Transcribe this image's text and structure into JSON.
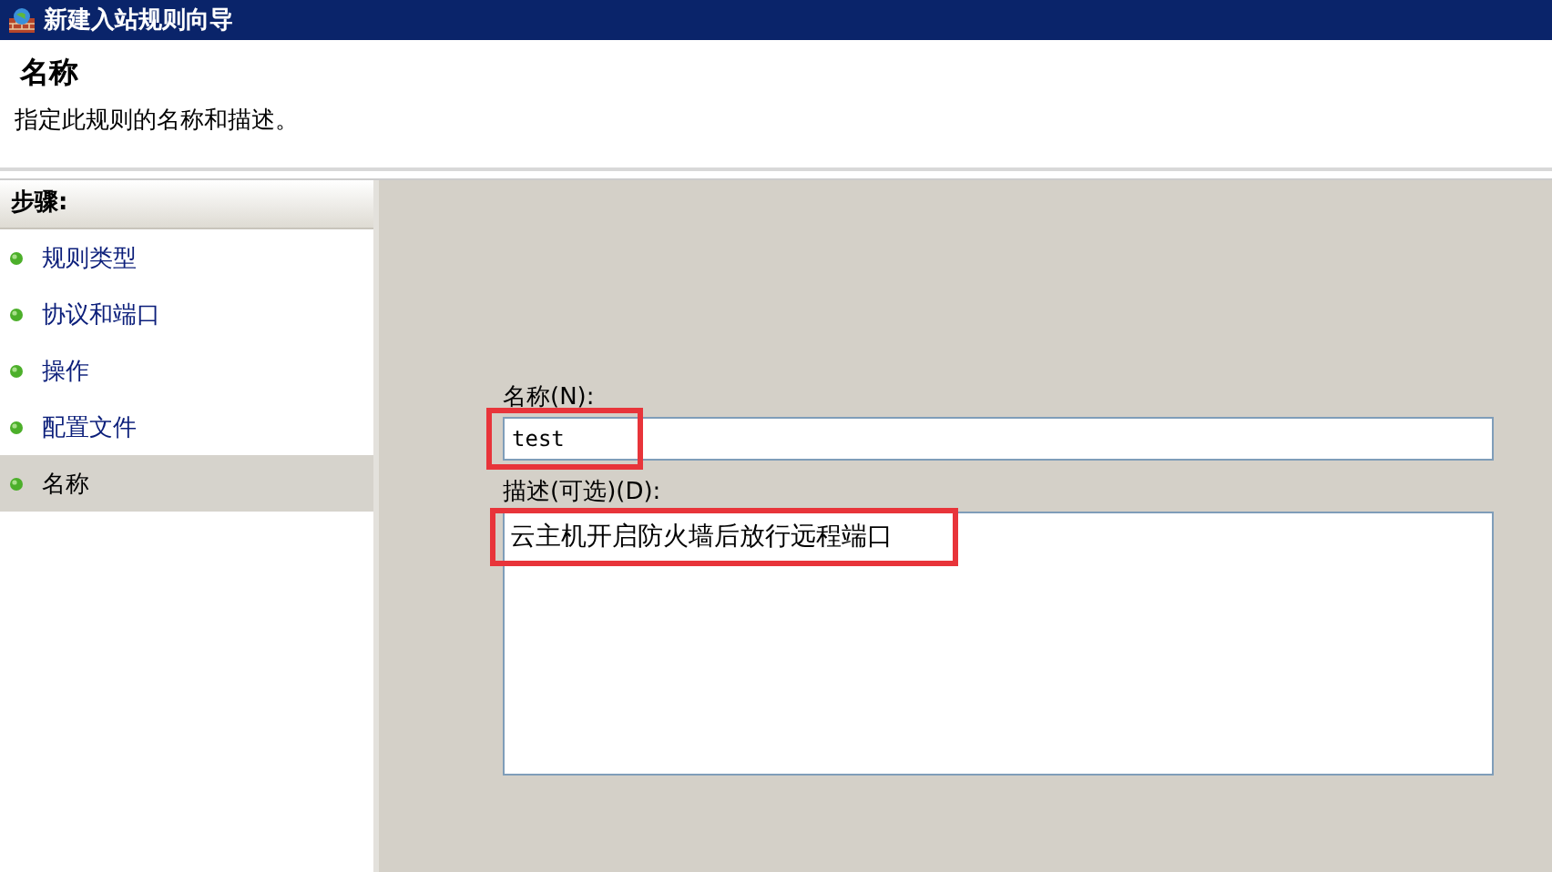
{
  "window": {
    "title": "新建入站规则向导"
  },
  "header": {
    "title": "名称",
    "description": "指定此规则的名称和描述。"
  },
  "steps": {
    "title": "步骤:",
    "items": [
      {
        "label": "规则类型",
        "selected": false
      },
      {
        "label": "协议和端口",
        "selected": false
      },
      {
        "label": "操作",
        "selected": false
      },
      {
        "label": "配置文件",
        "selected": false
      },
      {
        "label": "名称",
        "selected": true
      }
    ]
  },
  "form": {
    "name_field": {
      "label": "名称(N):",
      "value": "test",
      "highlighted": true
    },
    "description_field": {
      "label": "描述(可选)(D):",
      "value": "云主机开启防火墙后放行远程端口",
      "highlighted": true
    }
  }
}
